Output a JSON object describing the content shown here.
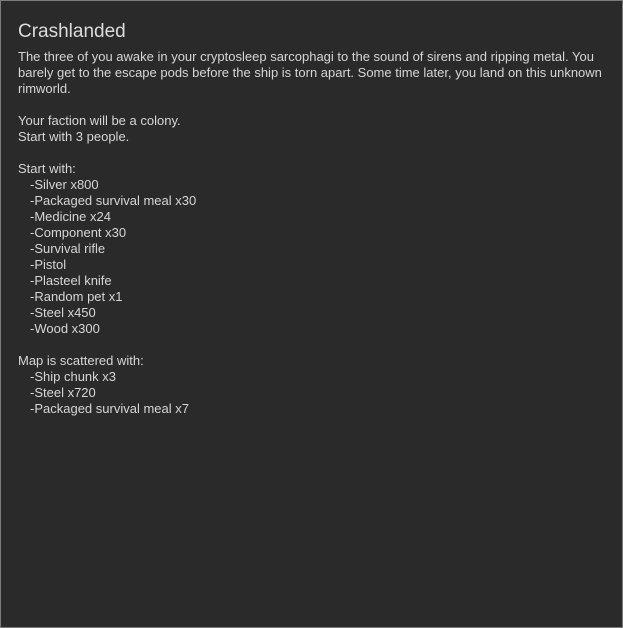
{
  "scenario": {
    "title": "Crashlanded",
    "description": "The three of you awake in your cryptosleep sarcophagi to the sound of sirens and ripping metal. You barely get to the escape pods before the ship is torn apart. Some time later, you land on this unknown rimworld.",
    "faction_line": "Your faction will be a colony.",
    "people_line": "Start with 3 people.",
    "start_with_heading": "Start with:",
    "start_with_items": [
      "-Silver x800",
      "-Packaged survival meal x30",
      "-Medicine x24",
      "-Component x30",
      "-Survival rifle",
      "-Pistol",
      "-Plasteel knife",
      "-Random pet x1",
      "-Steel x450",
      "-Wood x300"
    ],
    "map_heading": "Map is scattered with:",
    "map_items": [
      "-Ship chunk x3",
      "-Steel x720",
      "-Packaged survival meal x7"
    ]
  }
}
